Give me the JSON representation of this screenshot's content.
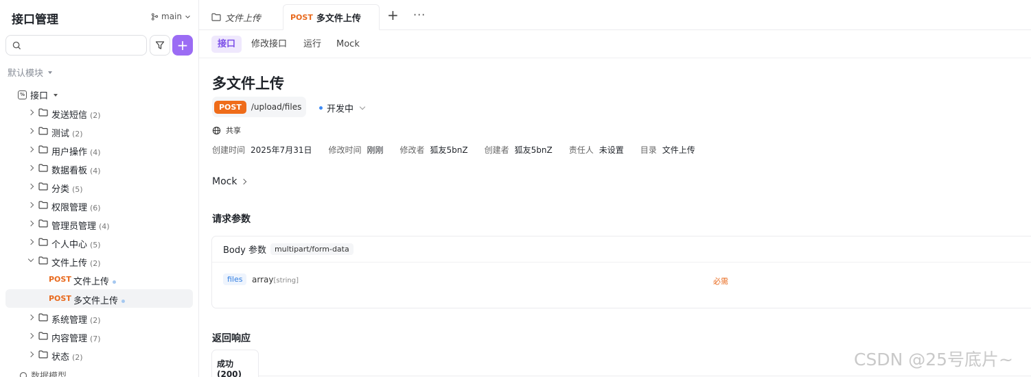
{
  "sidebar": {
    "title": "接口管理",
    "branch": "main",
    "search_placeholder": "",
    "module_label": "默认模块",
    "root_label": "接口",
    "items": [
      {
        "label": "发送短信",
        "count": "(2)"
      },
      {
        "label": "测试",
        "count": "(2)"
      },
      {
        "label": "用户操作",
        "count": "(4)"
      },
      {
        "label": "数据看板",
        "count": "(4)"
      },
      {
        "label": "分类",
        "count": "(5)"
      },
      {
        "label": "权限管理",
        "count": "(6)"
      },
      {
        "label": "管理员管理",
        "count": "(4)"
      },
      {
        "label": "个人中心",
        "count": "(5)"
      },
      {
        "label": "文件上传",
        "count": "(2)"
      }
    ],
    "leaves": [
      {
        "method": "POST",
        "label": "文件上传"
      },
      {
        "method": "POST",
        "label": "多文件上传"
      }
    ],
    "items_after": [
      {
        "label": "系统管理",
        "count": "(2)"
      },
      {
        "label": "内容管理",
        "count": "(7)"
      },
      {
        "label": "状态",
        "count": "(2)"
      }
    ],
    "bottom_label": "数据模型"
  },
  "tabs": {
    "tab1_label": "文件上传",
    "tab2_method": "POST",
    "tab2_label": "多文件上传"
  },
  "subtabs": [
    "接口",
    "修改接口",
    "运行",
    "Mock"
  ],
  "detail": {
    "title": "多文件上传",
    "method": "POST",
    "path": "/upload/files",
    "status": "开发中",
    "shared": "共享",
    "meta": [
      {
        "k": "创建时间",
        "v": "2025年7月31日"
      },
      {
        "k": "修改时间",
        "v": "刚刚"
      },
      {
        "k": "修改者",
        "v": "狐友5bnZ"
      },
      {
        "k": "创建者",
        "v": "狐友5bnZ"
      },
      {
        "k": "责任人",
        "v": "未设置"
      },
      {
        "k": "目录",
        "v": "文件上传"
      }
    ],
    "mock_label": "Mock",
    "params_title": "请求参数",
    "body_label": "Body 参数",
    "content_type": "multipart/form-data",
    "param": {
      "name": "files",
      "type": "array",
      "subtype": "[string]",
      "required": "必需"
    },
    "response_title": "返回响应",
    "response_tab": "成功(200)"
  },
  "watermark": "CSDN @25号底片~",
  "colors": {
    "accent": "#9b6cf4",
    "post": "#ef6c1a",
    "active_tab_bg": "#efe8fd"
  }
}
